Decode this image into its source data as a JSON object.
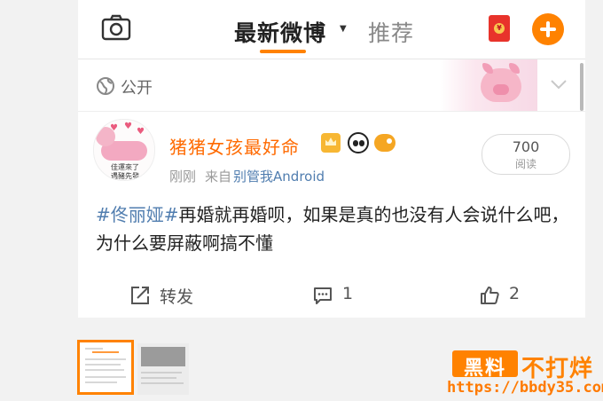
{
  "header": {
    "tabs": [
      {
        "label": "最新微博",
        "active": true
      },
      {
        "label": "推荐",
        "active": false
      }
    ],
    "accent_color": "#ff8200"
  },
  "visibility": {
    "label": "公开"
  },
  "post": {
    "username": "猪猪女孩最好命",
    "avatar_caption_lines": [
      "佳運來了",
      "遇豬先發"
    ],
    "time": "刚刚",
    "source_prefix": "来自",
    "source": "别管我Android",
    "reads": {
      "count": "700",
      "label": "阅读"
    },
    "hashtag": "#佟丽娅#",
    "text": "再婚就再婚呗，如果是真的也没有人会说什么吧，为什么要屏蔽啊搞不懂",
    "actions": {
      "repost": "转发",
      "comment": "1",
      "like": "2"
    }
  },
  "watermark": {
    "box": "黑料",
    "text": "不打烊",
    "url": "https://bbdy35.com"
  }
}
